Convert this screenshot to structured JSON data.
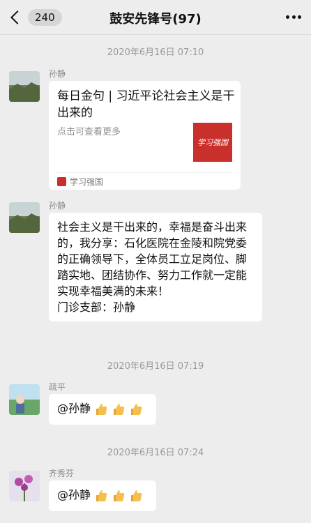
{
  "header": {
    "back_count": "240",
    "title": "鼓安先锋号(97)"
  },
  "messages": [
    {
      "timestamp": "2020年6月16日 07:10"
    },
    {
      "sender": "孙静",
      "card": {
        "title": "每日金句 | 习近平论社会主义是干出来的",
        "desc": "点击可查看更多",
        "thumb_text": "学习强国",
        "source": "学习强国"
      }
    },
    {
      "sender": "孙静",
      "text": "社会主义是干出来的，幸福是奋斗出来的，我分享：石化医院在金陵和院党委的正确领导下，全体员工立足岗位、脚踏实地、团结协作、努力工作就一定能实现幸福美满的未来！\n门诊支部：孙静"
    },
    {
      "timestamp": "2020年6月16日 07:19"
    },
    {
      "sender": "疏平",
      "text": "@孙静 ",
      "emoji": "thumbs-up x3"
    },
    {
      "timestamp": "2020年6月16日 07:24"
    },
    {
      "sender": "齐秀芬",
      "text": "@孙静 ",
      "emoji": "thumbs-up x3"
    }
  ],
  "colors": {
    "accent_red": "#c9302c",
    "bubble": "#ffffff",
    "background": "#ededed"
  }
}
